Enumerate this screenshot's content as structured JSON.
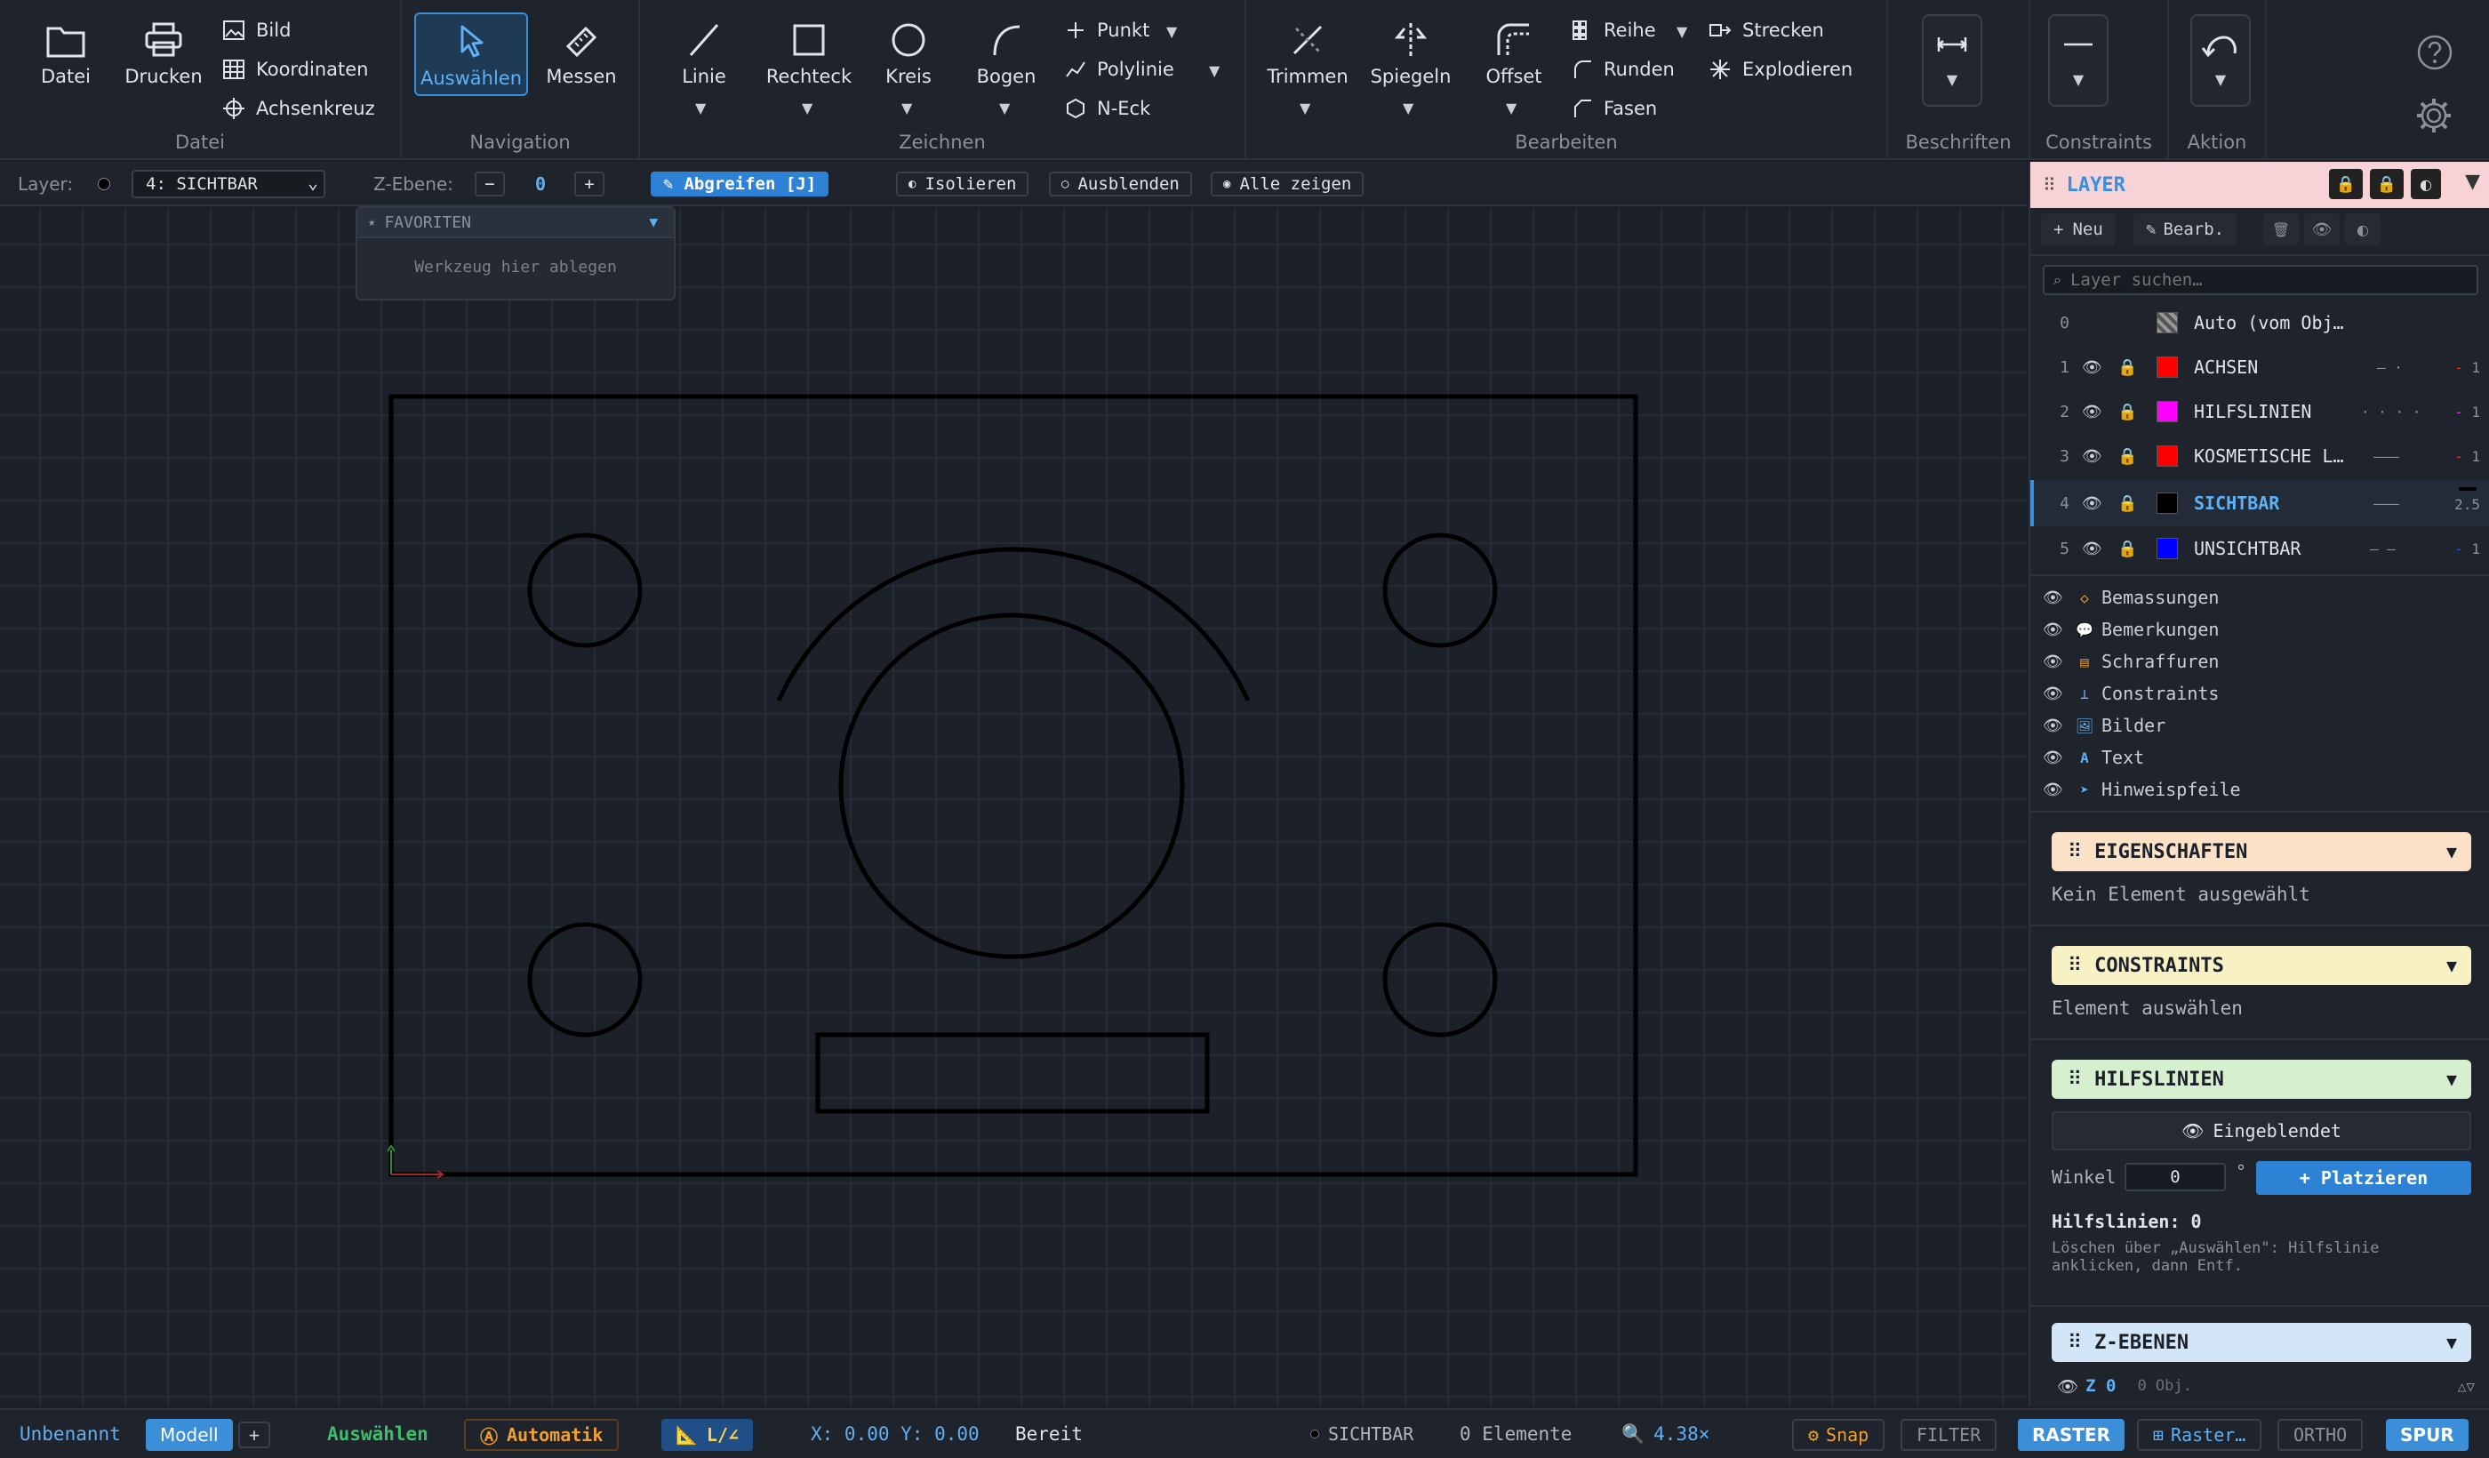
{
  "ribbon": {
    "datei": {
      "group": "Datei",
      "open": "Datei",
      "print": "Drucken",
      "image": "Bild",
      "coords": "Koordinaten",
      "crosshair": "Achsenkreuz"
    },
    "navigation": {
      "group": "Navigation",
      "select": "Auswählen",
      "measure": "Messen"
    },
    "zeichnen": {
      "group": "Zeichnen",
      "line": "Linie",
      "rect": "Rechteck",
      "circle": "Kreis",
      "arc": "Bogen",
      "point": "Punkt",
      "polyline": "Polylinie",
      "ngon": "N-Eck"
    },
    "bearbeiten": {
      "group": "Bearbeiten",
      "trim": "Trimmen",
      "mirror": "Spiegeln",
      "offset": "Offset",
      "array": "Reihe",
      "fillet": "Runden",
      "chamfer": "Fasen",
      "stretch": "Strecken",
      "explode": "Explodieren"
    },
    "beschriften": {
      "group": "Beschriften"
    },
    "constraints": {
      "group": "Constraints"
    },
    "aktion": {
      "group": "Aktion"
    }
  },
  "toolbar2": {
    "layer_label": "Layer:",
    "layer_value": "4: SICHTBAR",
    "z_label": "Z-Ebene:",
    "z_minus": "−",
    "z_value": "0",
    "z_plus": "+",
    "pick": "Abgreifen [J]",
    "isolate": "Isolieren",
    "hide": "Ausblenden",
    "show_all": "Alle zeigen"
  },
  "favorites": {
    "title": "FAVORITEN",
    "hint": "Werkzeug hier ablegen"
  },
  "layer_panel": {
    "title": "LAYER",
    "new": "Neu",
    "edit": "Bearb.",
    "search_placeholder": "Layer suchen…",
    "layers": [
      {
        "num": "0",
        "name": "Auto (vom Obj…",
        "color": "#888888",
        "style": "",
        "width": ""
      },
      {
        "num": "1",
        "name": "ACHSEN",
        "color": "#ff0000",
        "style": "— ·",
        "width": "1"
      },
      {
        "num": "2",
        "name": "HILFSLINIEN",
        "color": "#ff00ff",
        "style": "· · · ·",
        "width": "1"
      },
      {
        "num": "3",
        "name": "KOSMETISCHE L…",
        "color": "#ff0000",
        "style": "———",
        "width": "1"
      },
      {
        "num": "4",
        "name": "SICHTBAR",
        "color": "#000000",
        "style": "———",
        "width": "2.5"
      },
      {
        "num": "5",
        "name": "UNSICHTBAR",
        "color": "#0000ff",
        "style": "— —",
        "width": "1"
      }
    ],
    "categories": [
      "Bemassungen",
      "Bemerkungen",
      "Schraffuren",
      "Constraints",
      "Bilder",
      "Text",
      "Hinweispfeile"
    ]
  },
  "properties": {
    "title": "EIGENSCHAFTEN",
    "text": "Kein Element ausgewählt"
  },
  "constraints_panel": {
    "title": "CONSTRAINTS",
    "text": "Element auswählen"
  },
  "guides": {
    "title": "HILFSLINIEN",
    "toggle": "Eingeblendet",
    "angle_label": "Winkel",
    "angle_value": "0",
    "deg": "°",
    "place": "+ Platzieren",
    "count_label": "Hilfslinien:",
    "count": "0",
    "note": "Löschen über „Auswählen\": Hilfslinie anklicken, dann Entf."
  },
  "zlevels": {
    "title": "Z-EBENEN",
    "z_name": "Z 0",
    "z_count": "0 Obj."
  },
  "status": {
    "file": "Unbenannt",
    "model": "Modell",
    "add": "+",
    "tool": "Auswählen",
    "auto": "Automatik",
    "angle": "L/∠",
    "coords": "X: 0.00 Y: 0.00",
    "state": "Bereit",
    "layer": "SICHTBAR",
    "elements": "0 Elemente",
    "zoom": "4.38×",
    "snap": "Snap",
    "filter": "FILTER",
    "raster": "RASTER",
    "raster_opts": "Raster…",
    "ortho": "ORTHO",
    "spur": "SPUR"
  }
}
